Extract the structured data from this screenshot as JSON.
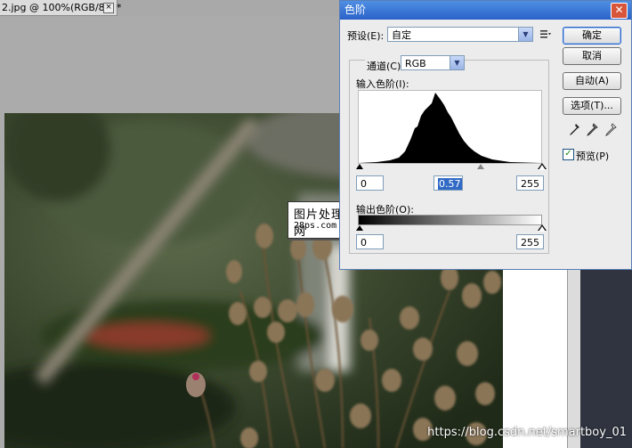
{
  "document": {
    "tab_title": "2.jpg @ 100%(RGB/8*) *",
    "close_glyph": "×"
  },
  "watermark": {
    "line1": "图片处理教程网",
    "line2": "28ps.com"
  },
  "dialog": {
    "title": "色阶",
    "close_glyph": "✕",
    "preset_label": "预设(E):",
    "preset_value": "自定",
    "preset_menu_icon": "options-menu-icon",
    "channel_label": "通道(C):",
    "channel_value": "RGB",
    "input_levels_label": "输入色阶(I):",
    "input_black": "0",
    "input_gamma": "0.57",
    "input_white": "255",
    "output_levels_label": "输出色阶(O):",
    "output_black": "0",
    "output_white": "255",
    "buttons": {
      "ok": "确定",
      "cancel": "取消",
      "auto": "自动(A)",
      "options": "选项(T)..."
    },
    "preview_label": "预览(P)",
    "preview_checked": true,
    "preview_check_glyph": "✓",
    "dropdown_arrow": "▼",
    "accent_title": "#2a62c9"
  },
  "footer": {
    "url": "https://blog.csdn.net/smartboy_01"
  }
}
